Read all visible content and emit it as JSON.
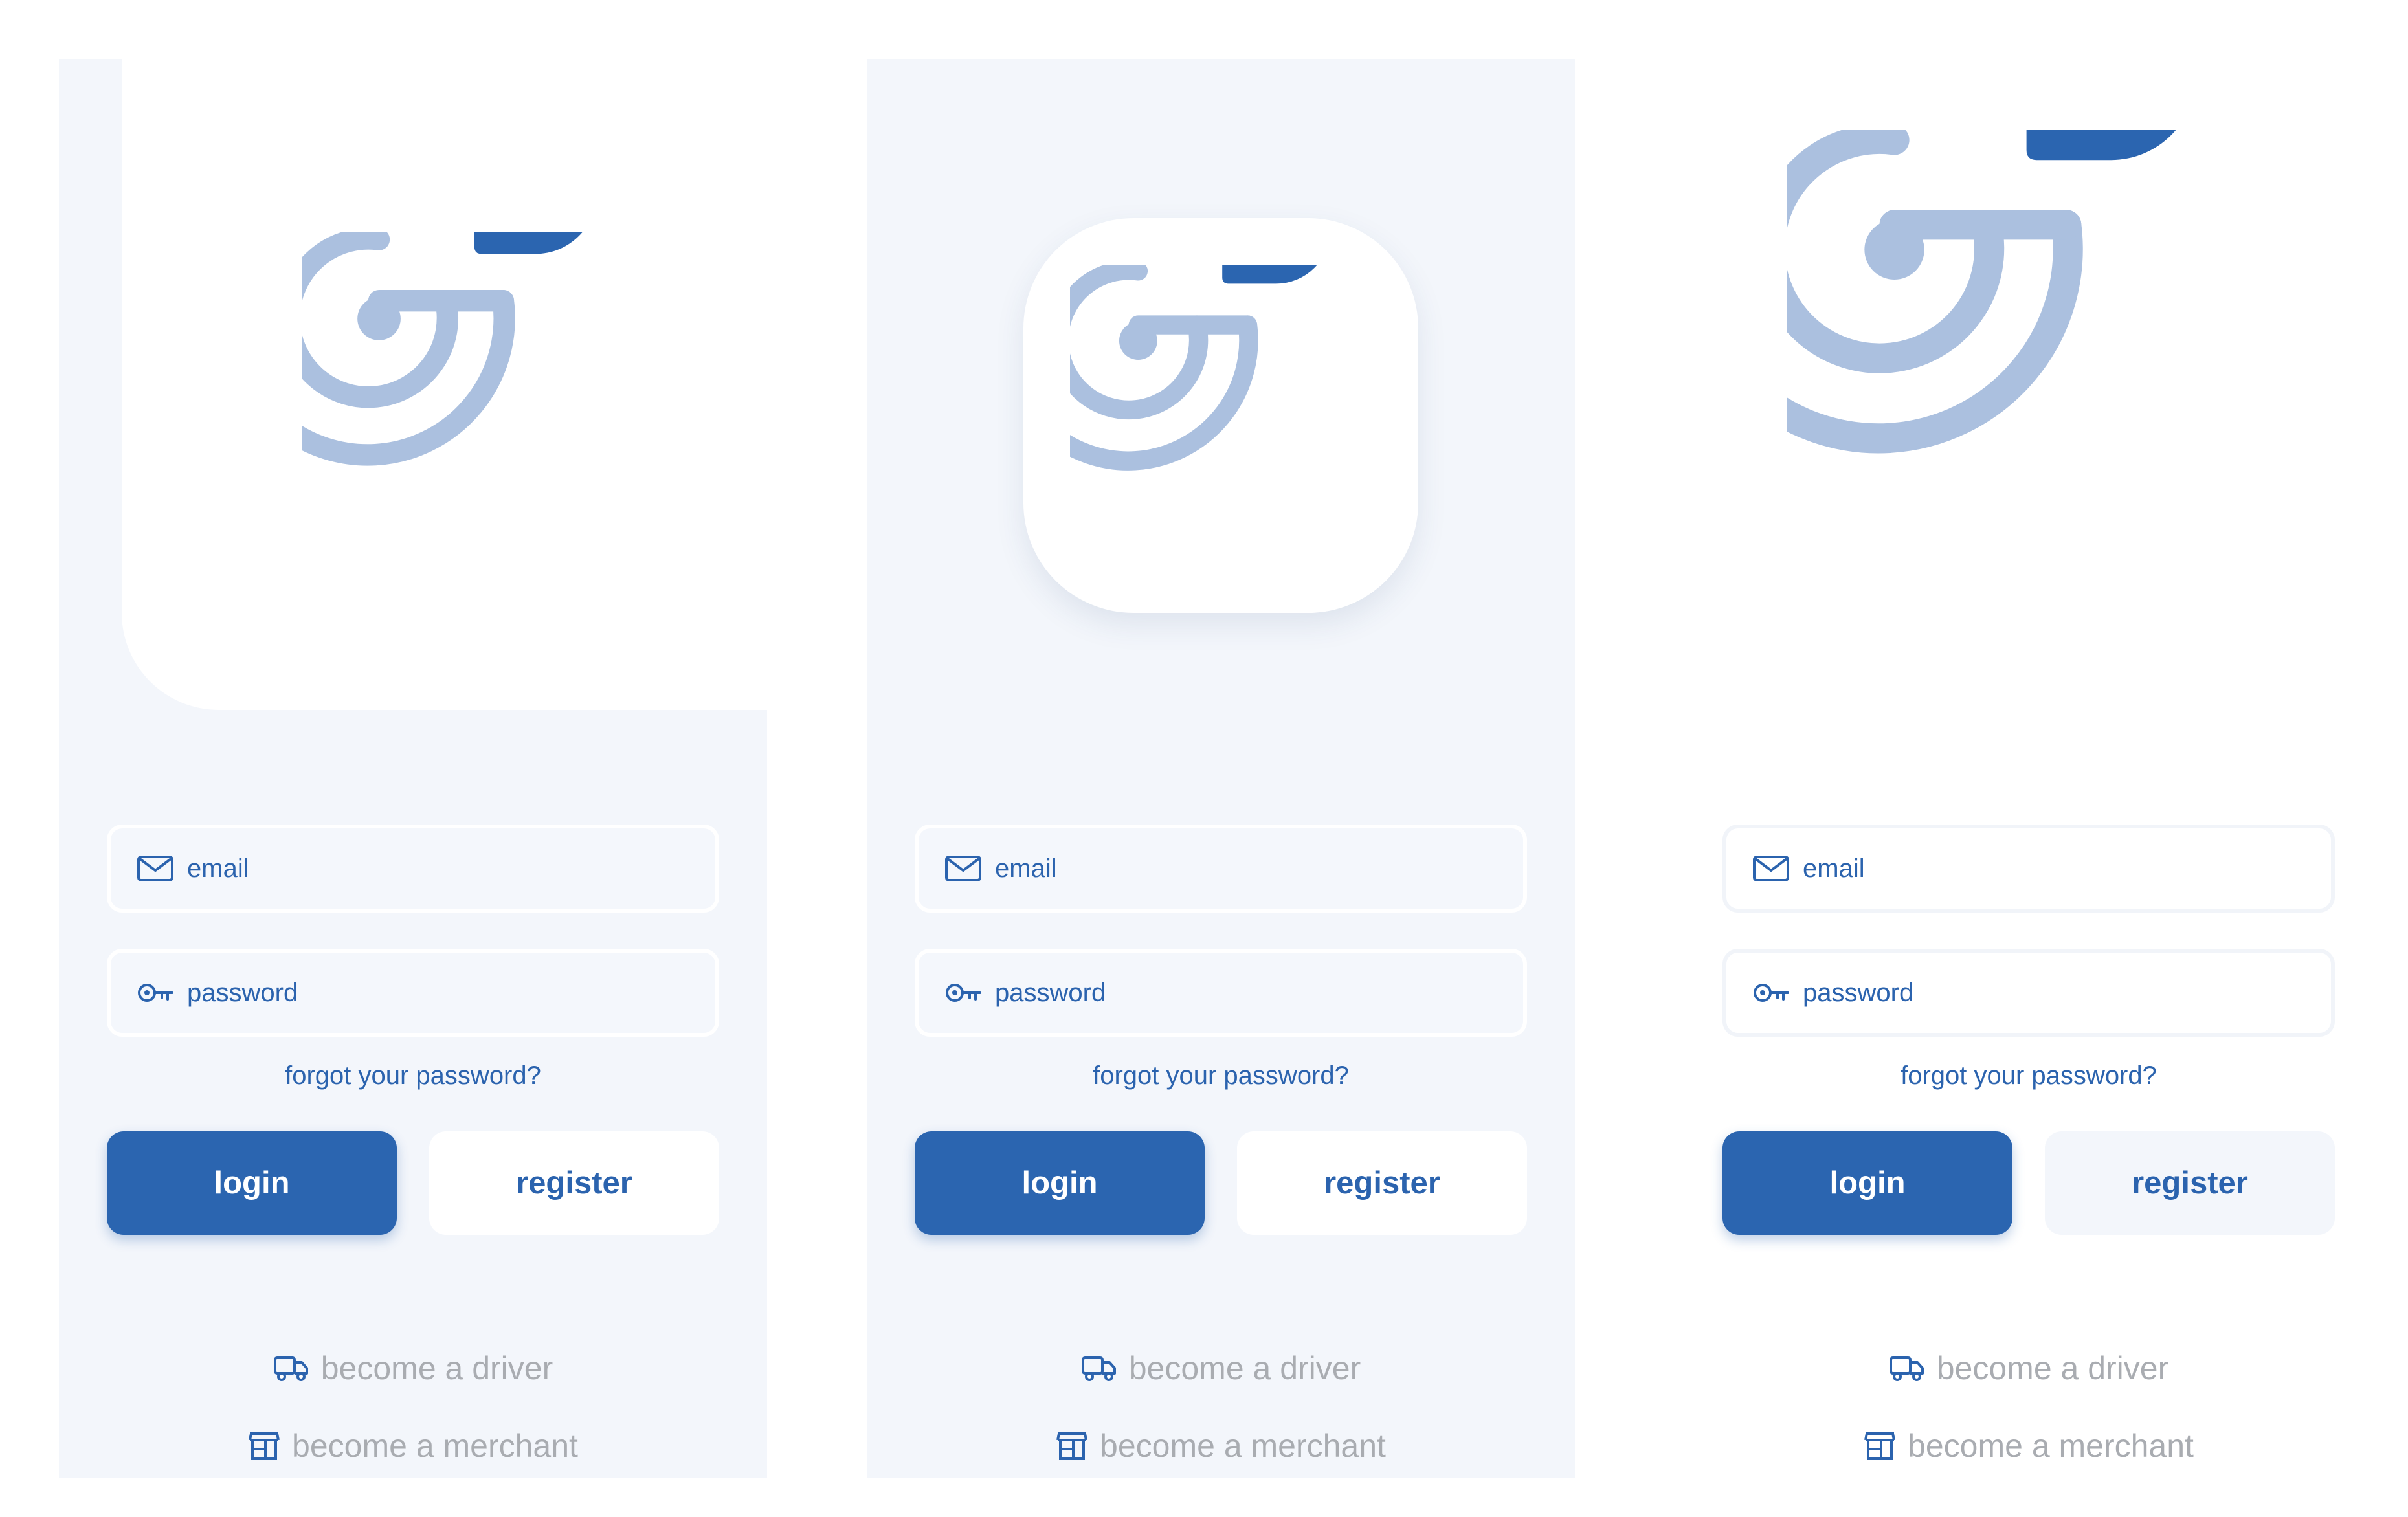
{
  "colors": {
    "primary": "#2b65b0",
    "logo_light": "#abc0df",
    "panel_bg": "#f3f6fb",
    "muted_text": "#a9acb1"
  },
  "icons": {
    "logo": "g-location-pin-logo",
    "email": "envelope-icon",
    "password": "key-icon",
    "driver": "truck-icon",
    "merchant": "storefront-icon"
  },
  "variants": [
    {
      "email_placeholder": "email",
      "password_placeholder": "password",
      "forgot_link": "forgot your password?",
      "login_label": "login",
      "register_label": "register",
      "driver_link": "become a driver",
      "merchant_link": "become a merchant"
    },
    {
      "email_placeholder": "email",
      "password_placeholder": "password",
      "forgot_link": "forgot your password?",
      "login_label": "login",
      "register_label": "register",
      "driver_link": "become a driver",
      "merchant_link": "become a merchant"
    },
    {
      "email_placeholder": "email",
      "password_placeholder": "password",
      "forgot_link": "forgot your password?",
      "login_label": "login",
      "register_label": "register",
      "driver_link": "become a driver",
      "merchant_link": "become a merchant"
    }
  ]
}
